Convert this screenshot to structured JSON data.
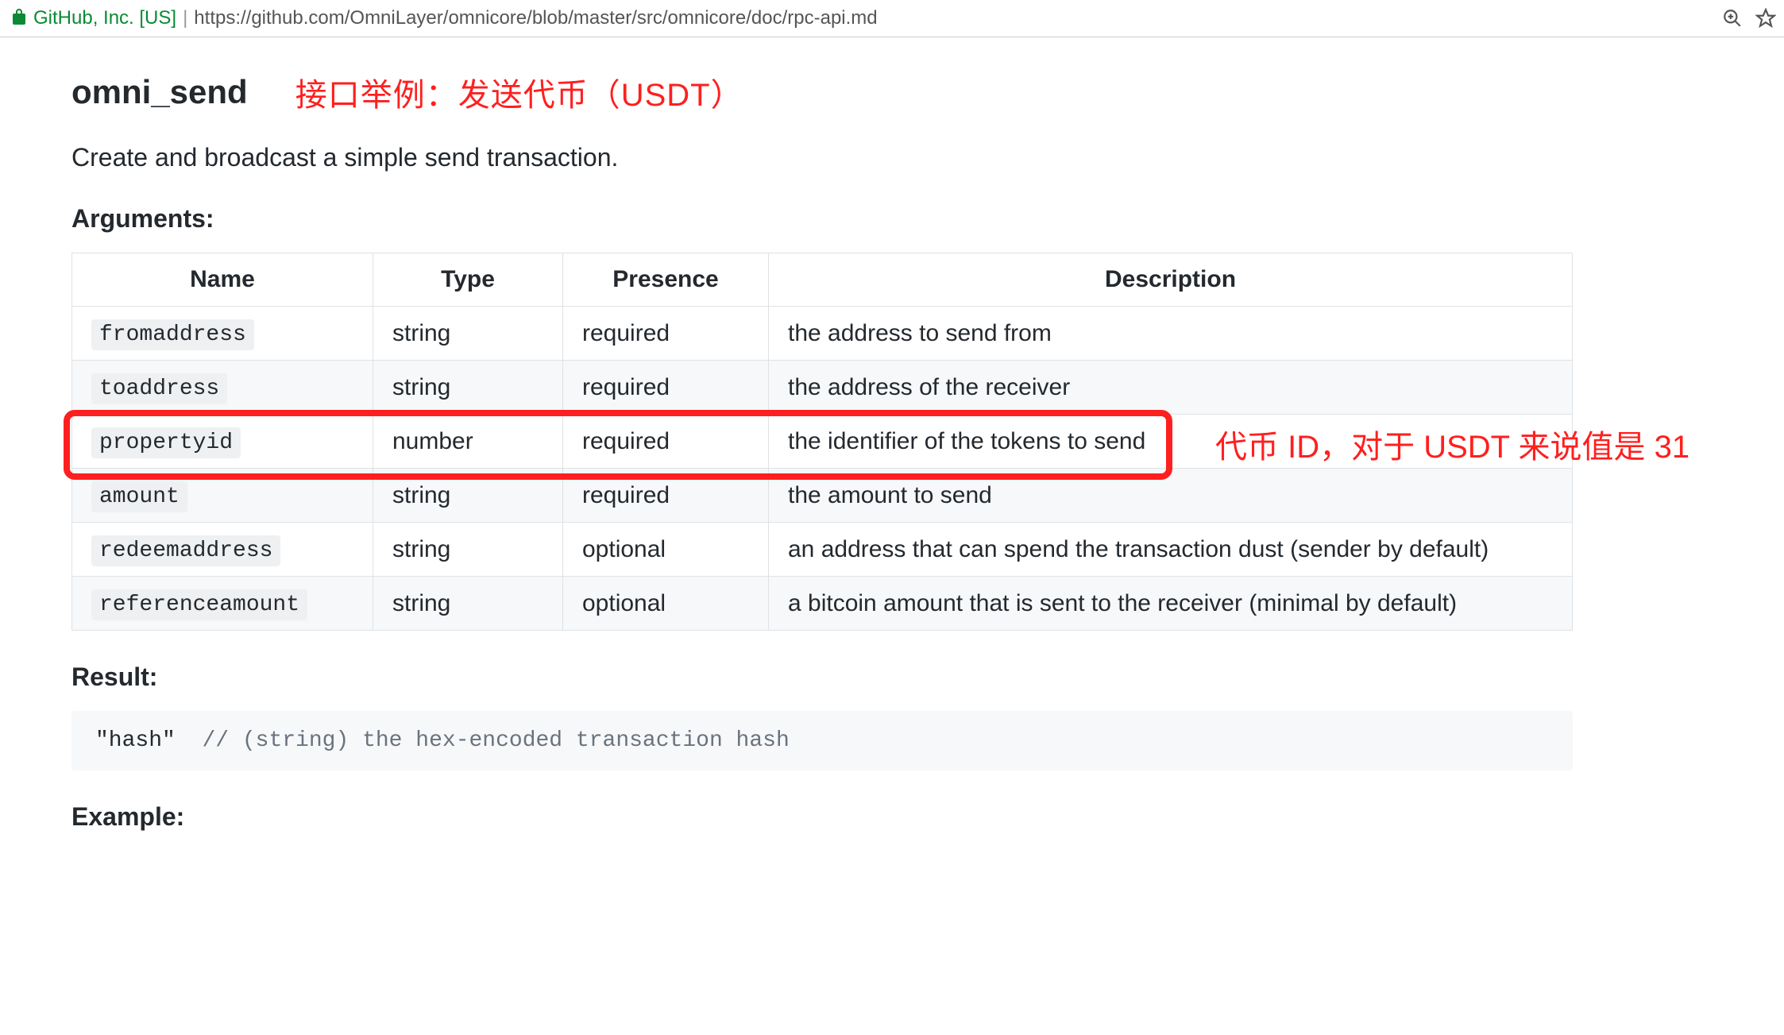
{
  "browser": {
    "org": "GitHub, Inc. [US]",
    "url": "https://github.com/OmniLayer/omnicore/blob/master/src/omnicore/doc/rpc-api.md"
  },
  "doc": {
    "api_name": "omni_send",
    "title_annotation": "接口举例：发送代币（USDT）",
    "lead": "Create and broadcast a simple send transaction.",
    "arguments_heading": "Arguments:",
    "result_heading": "Result:",
    "example_heading": "Example:",
    "table": {
      "headers": {
        "name": "Name",
        "type": "Type",
        "presence": "Presence",
        "description": "Description"
      },
      "rows": [
        {
          "name": "fromaddress",
          "type": "string",
          "presence": "required",
          "description": "the address to send from"
        },
        {
          "name": "toaddress",
          "type": "string",
          "presence": "required",
          "description": "the address of the receiver"
        },
        {
          "name": "propertyid",
          "type": "number",
          "presence": "required",
          "description": "the identifier of the tokens to send"
        },
        {
          "name": "amount",
          "type": "string",
          "presence": "required",
          "description": "the amount to send"
        },
        {
          "name": "redeemaddress",
          "type": "string",
          "presence": "optional",
          "description": "an address that can spend the transaction dust (sender by default)"
        },
        {
          "name": "referenceamount",
          "type": "string",
          "presence": "optional",
          "description": "a bitcoin amount that is sent to the receiver (minimal by default)"
        }
      ]
    },
    "highlight_annotation": "代币 ID，对于 USDT 来说值是 31",
    "result_code": {
      "value": "\"hash\"",
      "comment": "// (string) the hex-encoded transaction hash"
    }
  }
}
